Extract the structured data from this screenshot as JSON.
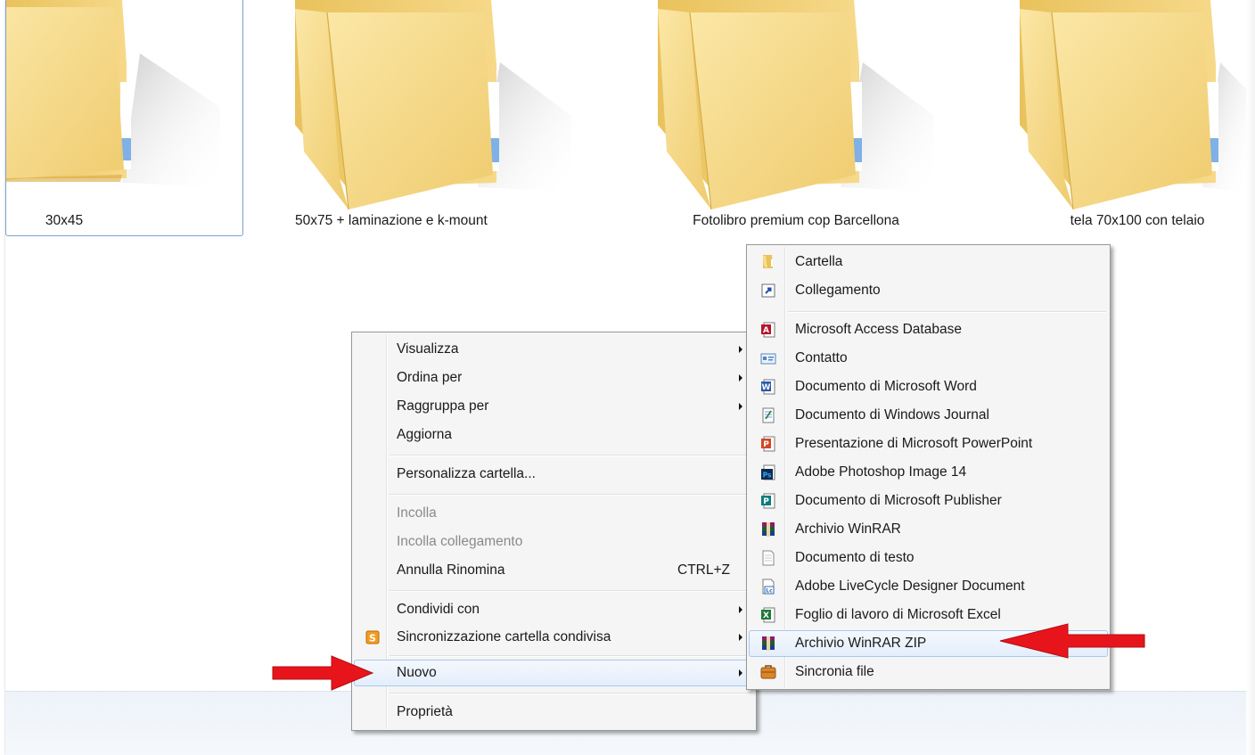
{
  "folders": [
    {
      "label": "30x45"
    },
    {
      "label": "50x75 + laminazione e k-mount"
    },
    {
      "label": "Fotolibro premium cop Barcellona"
    },
    {
      "label": "tela 70x100 con telaio"
    }
  ],
  "context_menu": {
    "items": [
      {
        "label": "Visualizza",
        "has_submenu": true
      },
      {
        "label": "Ordina per",
        "has_submenu": true
      },
      {
        "label": "Raggruppa per",
        "has_submenu": true
      },
      {
        "label": "Aggiorna"
      },
      {
        "label": "Personalizza cartella..."
      },
      {
        "label": "Incolla",
        "disabled": true
      },
      {
        "label": "Incolla collegamento",
        "disabled": true
      },
      {
        "label": "Annulla Rinomina",
        "shortcut": "CTRL+Z"
      },
      {
        "label": "Condividi con",
        "has_submenu": true
      },
      {
        "label": "Sincronizzazione cartella condivisa",
        "has_submenu": true,
        "icon": "sharepoint-sync-icon",
        "icon_text": "S"
      },
      {
        "label": "Nuovo",
        "has_submenu": true,
        "highlighted": true
      },
      {
        "label": "Proprietà"
      }
    ]
  },
  "new_submenu": {
    "items": [
      {
        "label": "Cartella",
        "icon": "folder-icon"
      },
      {
        "label": "Collegamento",
        "icon": "shortcut-icon"
      },
      {
        "label": "Microsoft Access Database",
        "icon": "access-icon",
        "icon_text": "A"
      },
      {
        "label": "Contatto",
        "icon": "contact-icon"
      },
      {
        "label": "Documento di Microsoft Word",
        "icon": "word-icon",
        "icon_text": "W"
      },
      {
        "label": "Documento di Windows Journal",
        "icon": "journal-icon"
      },
      {
        "label": "Presentazione di Microsoft PowerPoint",
        "icon": "powerpoint-icon",
        "icon_text": "P"
      },
      {
        "label": "Adobe Photoshop Image 14",
        "icon": "photoshop-icon",
        "icon_text": "Ps"
      },
      {
        "label": "Documento di Microsoft Publisher",
        "icon": "publisher-icon",
        "icon_text": "P"
      },
      {
        "label": "Archivio WinRAR",
        "icon": "winrar-icon"
      },
      {
        "label": "Documento di testo",
        "icon": "text-document-icon"
      },
      {
        "label": "Adobe LiveCycle Designer Document",
        "icon": "livecycle-icon",
        "icon_text": "Lc"
      },
      {
        "label": "Foglio di lavoro di Microsoft Excel",
        "icon": "excel-icon",
        "icon_text": "X"
      },
      {
        "label": "Archivio WinRAR ZIP",
        "icon": "winrar-zip-icon",
        "highlighted": true
      },
      {
        "label": "Sincronia file",
        "icon": "briefcase-icon"
      }
    ]
  },
  "colors": {
    "highlight_border": "#a8c9ee",
    "annotation_arrow": "#e8141b",
    "folder_yellow": "#f2d478"
  }
}
